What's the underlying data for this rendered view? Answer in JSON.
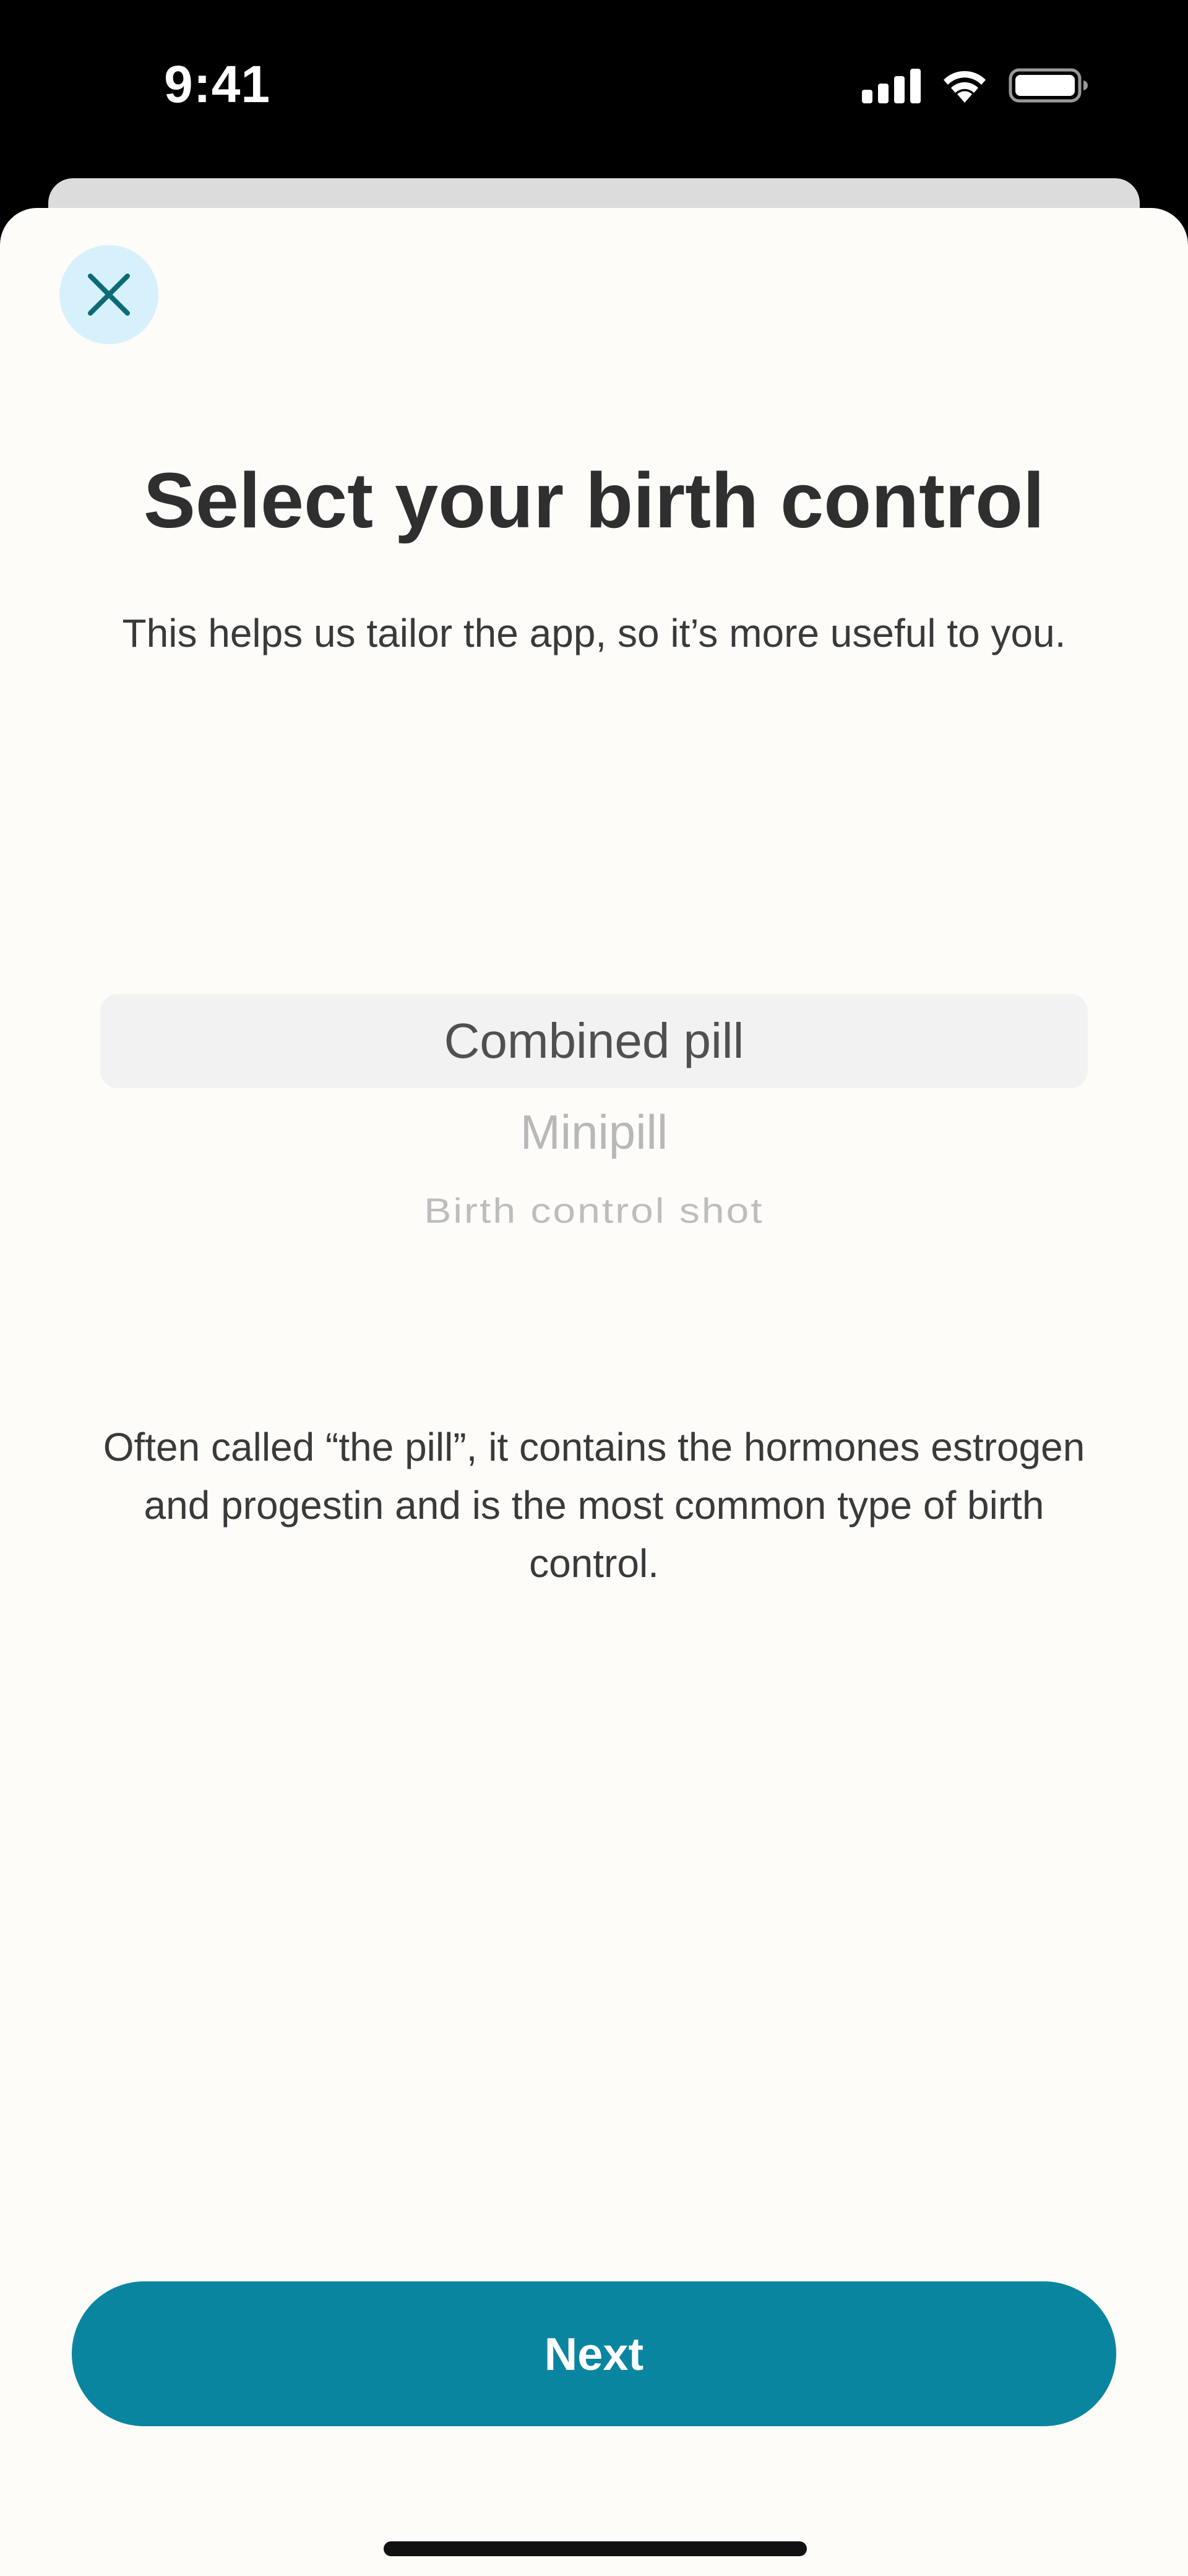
{
  "status_bar": {
    "time": "9:41",
    "icons": [
      "cellular-signal-icon",
      "wifi-icon",
      "battery-icon"
    ]
  },
  "modal": {
    "close_icon": "close-icon",
    "title": "Select your birth control",
    "subtitle": "This helps us tailor the app, so it’s more useful to you.",
    "picker": {
      "selected": "Combined pill",
      "options": [
        "Combined pill",
        "Minipill",
        "Birth control shot"
      ]
    },
    "description": "Often called “the pill”, it contains the hormones estrogen and progestin and is the most common type of birth control.",
    "next_label": "Next"
  },
  "colors": {
    "accent": "#0a859f",
    "close_bg": "#d6f1fb",
    "close_icon": "#0f6a78",
    "sheet_bg": "#fdfcf9",
    "text_primary": "#2f2f2f",
    "picker_highlight": "#f2f2f2"
  }
}
